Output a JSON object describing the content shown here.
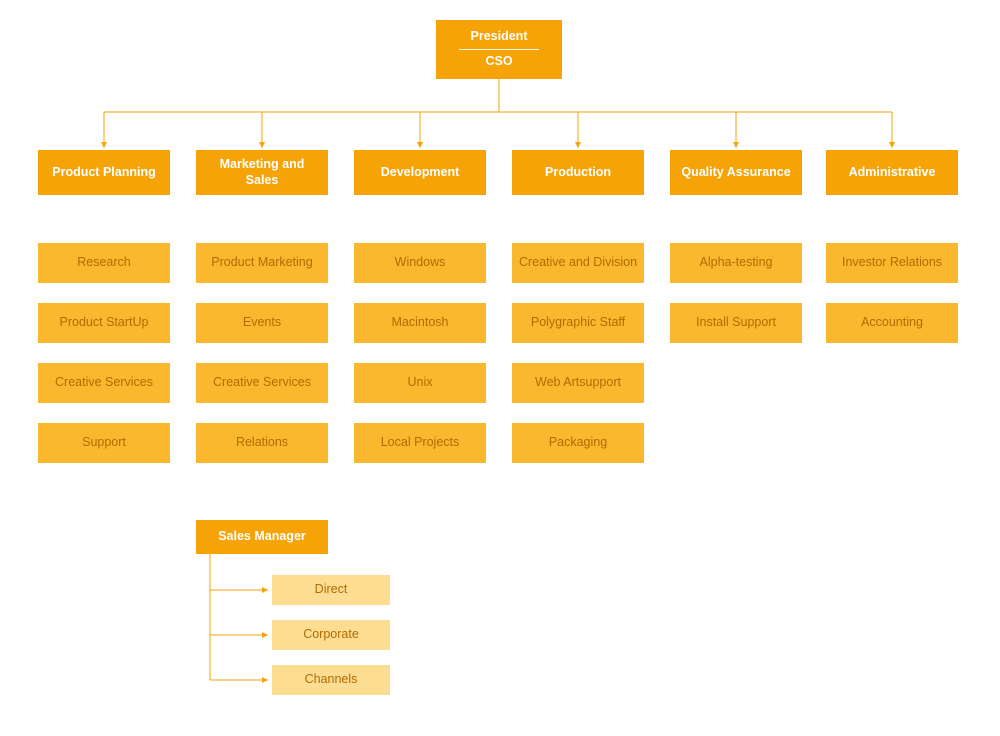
{
  "colors": {
    "dark": "#f6a308",
    "mid": "#f9b82e",
    "light": "#fcdd92",
    "connector": "#f6a308"
  },
  "top": {
    "president_label": "President",
    "cso_label": "CSO"
  },
  "departments": [
    {
      "name": "Product Planning",
      "subs": [
        "Research",
        "Product StartUp",
        "Creative Services",
        "Support"
      ]
    },
    {
      "name": "Marketing and Sales",
      "subs": [
        "Product Marketing",
        "Events",
        "Creative Services",
        "Relations"
      ],
      "manager": {
        "title": "Sales Manager",
        "teams": [
          "Direct",
          "Corporate",
          "Channels"
        ]
      }
    },
    {
      "name": "Development",
      "subs": [
        "Windows",
        "Macintosh",
        "Unix",
        "Local Projects"
      ]
    },
    {
      "name": "Production",
      "subs": [
        "Creative and Division",
        "Polygraphic Staff",
        "Web Artsupport",
        "Packaging"
      ]
    },
    {
      "name": "Quality Assurance",
      "subs": [
        "Alpha-testing",
        "Install Support"
      ]
    },
    {
      "name": "Administrative",
      "subs": [
        "Investor Relations",
        "Accounting"
      ]
    }
  ]
}
